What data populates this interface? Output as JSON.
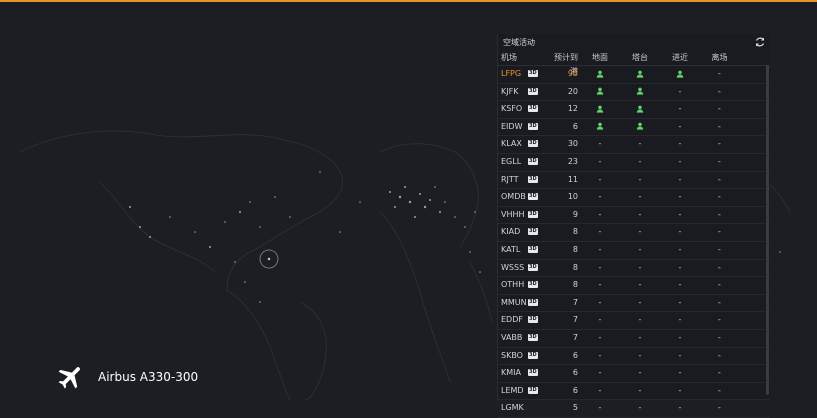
{
  "aircraft": {
    "name": "Airbus A330-300",
    "icon": "airplane-icon"
  },
  "panel": {
    "title": "空域活动",
    "refresh_icon": "refresh-icon",
    "columns": {
      "airport": "机场",
      "scheduled": "预计到港",
      "ground": "地面",
      "tower": "塔台",
      "approach": "进近",
      "departure": "离场"
    },
    "rows": [
      {
        "code": "LFPG",
        "badge": "3D",
        "count": "93",
        "ground": true,
        "tower": true,
        "approach": true,
        "departure": "-"
      },
      {
        "code": "KJFK",
        "badge": "3D",
        "count": "20",
        "ground": true,
        "tower": true,
        "approach": "-",
        "departure": "-"
      },
      {
        "code": "KSFO",
        "badge": "3D",
        "count": "12",
        "ground": true,
        "tower": true,
        "approach": "-",
        "departure": "-"
      },
      {
        "code": "EIDW",
        "badge": "3D",
        "count": "6",
        "ground": true,
        "tower": true,
        "approach": "-",
        "departure": "-"
      },
      {
        "code": "KLAX",
        "badge": "3D",
        "count": "30",
        "ground": "-",
        "tower": "-",
        "approach": "-",
        "departure": "-"
      },
      {
        "code": "EGLL",
        "badge": "3D",
        "count": "23",
        "ground": "-",
        "tower": "-",
        "approach": "-",
        "departure": "-"
      },
      {
        "code": "RJTT",
        "badge": "3D",
        "count": "11",
        "ground": "-",
        "tower": "-",
        "approach": "-",
        "departure": "-"
      },
      {
        "code": "OMDB",
        "badge": "3D",
        "count": "10",
        "ground": "-",
        "tower": "-",
        "approach": "-",
        "departure": "-"
      },
      {
        "code": "VHHH",
        "badge": "3D",
        "count": "9",
        "ground": "-",
        "tower": "-",
        "approach": "-",
        "departure": "-"
      },
      {
        "code": "KIAD",
        "badge": "3D",
        "count": "8",
        "ground": "-",
        "tower": "-",
        "approach": "-",
        "departure": "-"
      },
      {
        "code": "KATL",
        "badge": "3D",
        "count": "8",
        "ground": "-",
        "tower": "-",
        "approach": "-",
        "departure": "-"
      },
      {
        "code": "WSSS",
        "badge": "3D",
        "count": "8",
        "ground": "-",
        "tower": "-",
        "approach": "-",
        "departure": "-"
      },
      {
        "code": "OTHH",
        "badge": "3D",
        "count": "8",
        "ground": "-",
        "tower": "-",
        "approach": "-",
        "departure": "-"
      },
      {
        "code": "MMUN",
        "badge": "3D",
        "count": "7",
        "ground": "-",
        "tower": "-",
        "approach": "-",
        "departure": "-"
      },
      {
        "code": "EDDF",
        "badge": "3D",
        "count": "7",
        "ground": "-",
        "tower": "-",
        "approach": "-",
        "departure": "-"
      },
      {
        "code": "VABB",
        "badge": "3D",
        "count": "7",
        "ground": "-",
        "tower": "-",
        "approach": "-",
        "departure": "-"
      },
      {
        "code": "SKBO",
        "badge": "3D",
        "count": "6",
        "ground": "-",
        "tower": "-",
        "approach": "-",
        "departure": "-"
      },
      {
        "code": "KMIA",
        "badge": "3D",
        "count": "6",
        "ground": "-",
        "tower": "-",
        "approach": "-",
        "departure": "-"
      },
      {
        "code": "LEMD",
        "badge": "3D",
        "count": "6",
        "ground": "-",
        "tower": "-",
        "approach": "-",
        "departure": "-"
      },
      {
        "code": "LGMK",
        "badge": "",
        "count": "5",
        "ground": "-",
        "tower": "-",
        "approach": "-",
        "departure": "-"
      }
    ]
  },
  "colors": {
    "accent": "#e8922e",
    "active": "#5fd36a",
    "background": "#1c1e23"
  }
}
